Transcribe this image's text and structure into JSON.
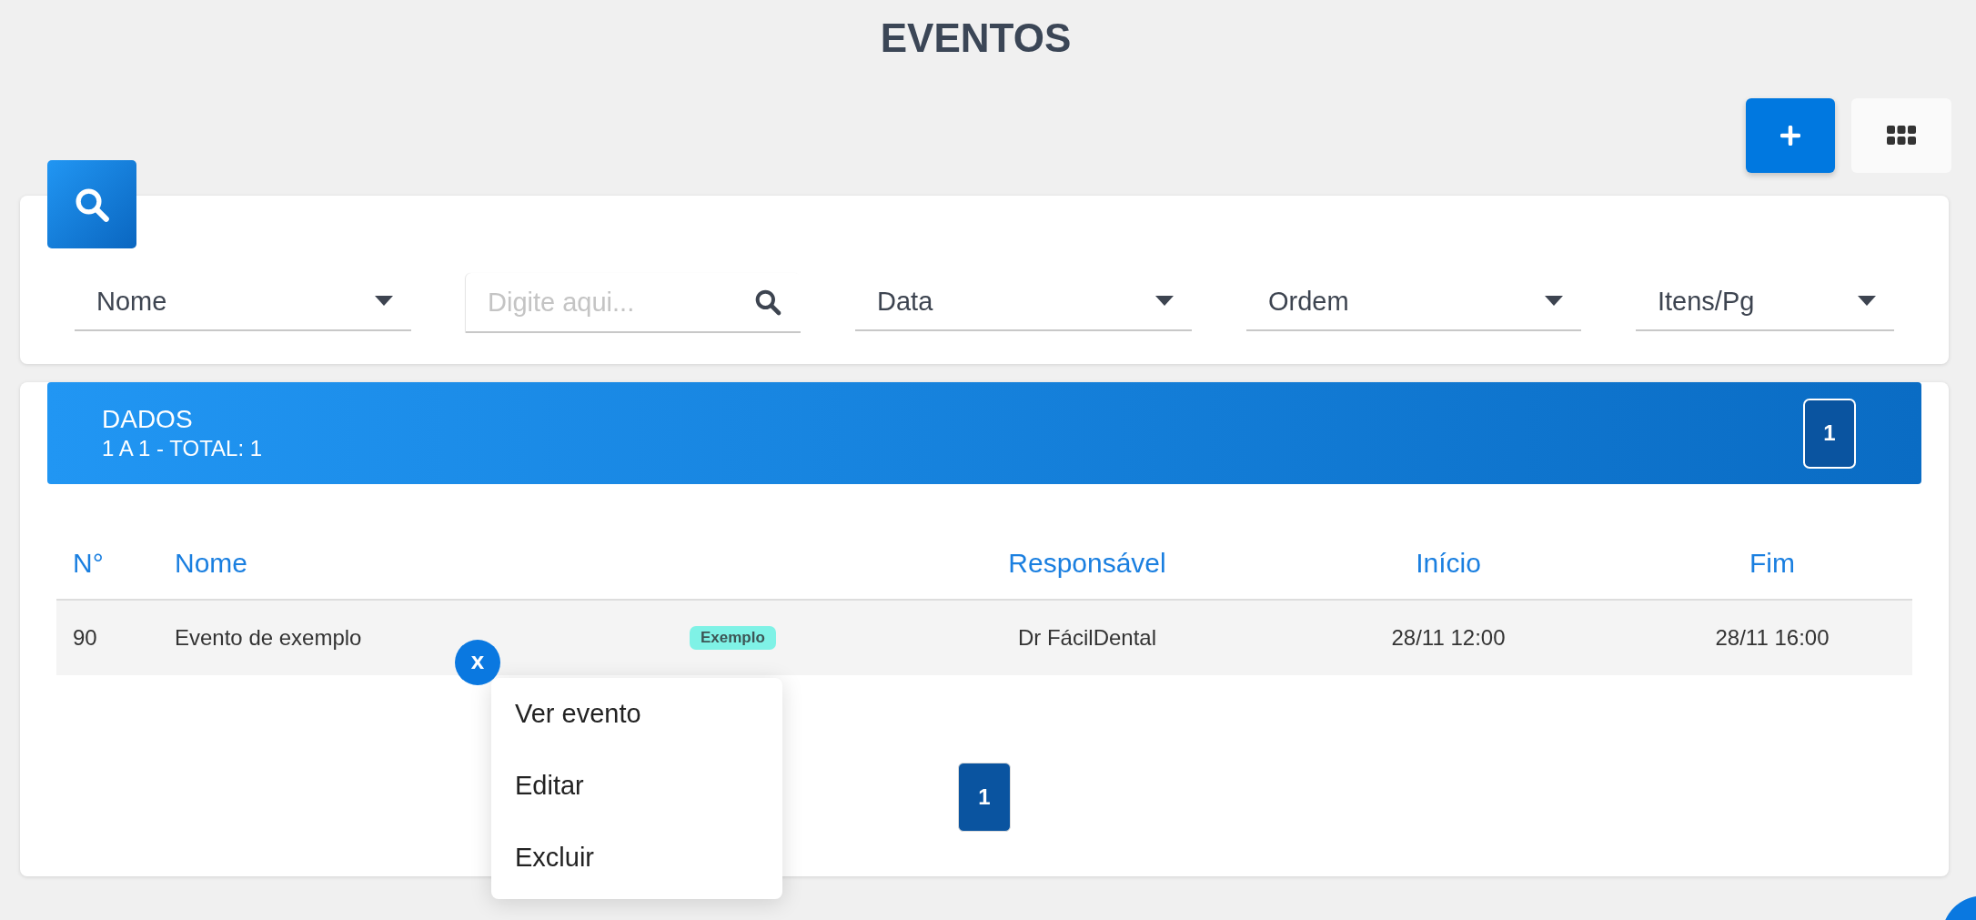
{
  "page": {
    "title": "EVENTOS"
  },
  "filters": [
    {
      "kind": "select",
      "value": "Nome"
    },
    {
      "kind": "search",
      "placeholder": "Digite aqui..."
    },
    {
      "kind": "select",
      "value": "Data"
    },
    {
      "kind": "select",
      "value": "Ordem"
    },
    {
      "kind": "select",
      "value": "Itens/Pg"
    }
  ],
  "data_panel": {
    "title": "DADOS",
    "summary": "1 A 1 - TOTAL: 1",
    "page_badge": "1"
  },
  "table": {
    "columns": [
      "N°",
      "Nome",
      "Responsável",
      "Início",
      "Fim"
    ],
    "rows": [
      {
        "cells": [
          "90",
          "Evento de exemplo",
          "Dr FácilDental",
          "28/11 12:00",
          "28/11 16:00"
        ],
        "tag": "Exemplo"
      }
    ]
  },
  "row_menu": {
    "close": "x",
    "items": [
      "Ver evento",
      "Editar",
      "Excluir"
    ]
  },
  "pagination": [
    {
      "label": "1",
      "selected": true
    }
  ]
}
